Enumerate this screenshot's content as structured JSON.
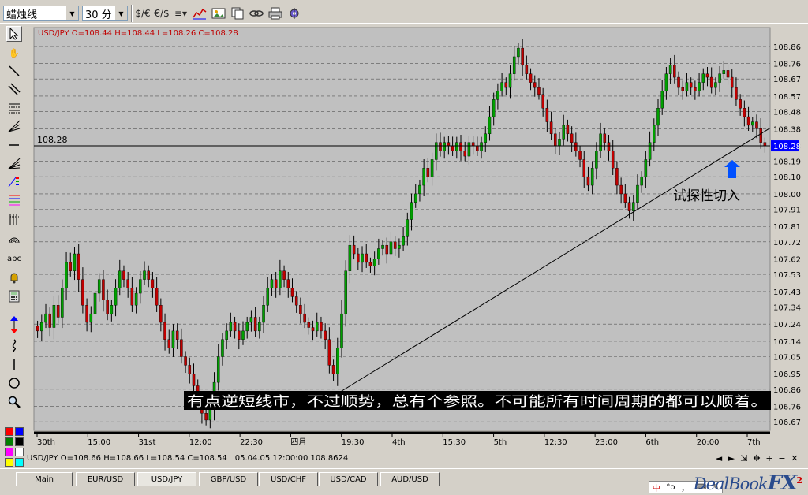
{
  "toolbar": {
    "chart_type": "蜡烛线",
    "timeframe": "30 分",
    "icons": [
      "dollar-euro-icon",
      "euro-dollar-icon",
      "indicator-icon",
      "chart-line-icon",
      "image-icon",
      "copy-icon",
      "link-icon",
      "print-icon",
      "settings-icon"
    ]
  },
  "left_tools": {
    "icons": [
      "cursor-icon",
      "hand-icon",
      "trendline-icon",
      "channel-icon",
      "gann-icon",
      "fan-icon",
      "horizontal-line-icon",
      "fibonacci-fan-icon",
      "cycle-icon",
      "fibonacci-icon",
      "grid-icon",
      "arc-icon",
      "text-icon",
      "bell-icon",
      "calculator-icon",
      "arrow-updown-icon",
      "wave-icon",
      "vertical-line-icon",
      "circle-icon",
      "zoom-icon"
    ],
    "text_tool_label": "abc",
    "colors": [
      "#ff0000",
      "#0000ff",
      "#008000",
      "#000000",
      "#ff00ff",
      "#ffffff",
      "#ffff00",
      "#00ffff",
      "#800000"
    ]
  },
  "chart": {
    "info": "USD/JPY O=108.44 H=108.44 L=108.26 C=108.28",
    "hline_label": "108.28",
    "price_tag": "108.28",
    "price_tag_color": "#0000ff",
    "annotation": "试探性切入",
    "caption": "有点逆短线市，不过顺势，总有个参照。不可能所有时间周期的都可以顺着。",
    "colors": {
      "background": "#c0c0c0",
      "bull": "#00a000",
      "bear": "#c00000",
      "wick": "#000000",
      "arrow": "#0050ff"
    }
  },
  "chart_data": {
    "type": "candlestick",
    "symbol": "USD/JPY",
    "timeframe": "30 分",
    "y_ticks": [
      108.86,
      108.76,
      108.67,
      108.57,
      108.48,
      108.38,
      108.28,
      108.19,
      108.1,
      108.0,
      107.91,
      107.81,
      107.72,
      107.62,
      107.53,
      107.43,
      107.34,
      107.24,
      107.14,
      107.05,
      106.95,
      106.86,
      106.76,
      106.67
    ],
    "ylim": [
      106.62,
      108.97
    ],
    "x_ticks": [
      "30th",
      "15:00",
      "31st",
      "12:00",
      "22:30",
      "四月",
      "19:30",
      "4th",
      "15:30",
      "5th",
      "12:30",
      "23:00",
      "6th",
      "20:00",
      "7th"
    ],
    "current_price": 108.28,
    "trendline": {
      "from": {
        "bar": 72,
        "price": 106.82
      },
      "to": {
        "bar": 178,
        "price": 108.38
      }
    },
    "closes": [
      107.2,
      107.25,
      107.3,
      107.22,
      107.35,
      107.28,
      107.45,
      107.6,
      107.55,
      107.65,
      107.5,
      107.35,
      107.25,
      107.3,
      107.42,
      107.5,
      107.38,
      107.3,
      107.35,
      107.45,
      107.55,
      107.5,
      107.45,
      107.35,
      107.42,
      107.5,
      107.55,
      107.5,
      107.45,
      107.35,
      107.25,
      107.15,
      107.1,
      107.2,
      107.15,
      107.05,
      107.0,
      106.95,
      106.88,
      106.8,
      106.72,
      106.68,
      106.75,
      106.9,
      107.05,
      107.15,
      107.2,
      107.25,
      107.2,
      107.15,
      107.2,
      107.25,
      107.28,
      107.2,
      107.25,
      107.35,
      107.45,
      107.5,
      107.45,
      107.55,
      107.5,
      107.45,
      107.4,
      107.35,
      107.3,
      107.25,
      107.22,
      107.2,
      107.25,
      107.2,
      107.15,
      107.0,
      106.95,
      107.1,
      107.3,
      107.55,
      107.7,
      107.65,
      107.6,
      107.65,
      107.6,
      107.58,
      107.62,
      107.68,
      107.7,
      107.65,
      107.72,
      107.68,
      107.7,
      107.75,
      107.85,
      107.95,
      108.0,
      108.05,
      108.15,
      108.1,
      108.2,
      108.3,
      108.25,
      108.3,
      108.28,
      108.25,
      108.3,
      108.25,
      108.22,
      108.3,
      108.28,
      108.25,
      108.3,
      108.35,
      108.45,
      108.55,
      108.6,
      108.65,
      108.62,
      108.7,
      108.8,
      108.85,
      108.75,
      108.7,
      108.65,
      108.62,
      108.58,
      108.5,
      108.42,
      108.35,
      108.28,
      108.32,
      108.4,
      108.35,
      108.3,
      108.25,
      108.2,
      108.1,
      108.05,
      108.15,
      108.25,
      108.35,
      108.3,
      108.25,
      108.15,
      108.05,
      108.0,
      107.95,
      107.9,
      107.95,
      108.05,
      108.1,
      108.2,
      108.3,
      108.4,
      108.5,
      108.6,
      108.7,
      108.75,
      108.68,
      108.62,
      108.6,
      108.65,
      108.62,
      108.6,
      108.65,
      108.7,
      108.68,
      108.62,
      108.65,
      108.7,
      108.72,
      108.68,
      108.62,
      108.55,
      108.5,
      108.45,
      108.4,
      108.42,
      108.38,
      108.3,
      108.28
    ]
  },
  "status": {
    "ohlc": "USD/JPY O=108.66 H=108.66 L=108.54 C=108.54",
    "info": "05.04.05 12:00:00 108.8624"
  },
  "tabs": [
    "Main",
    "EUR/USD",
    "USD/JPY",
    "GBP/USD",
    "USD/CHF",
    "USD/CAD",
    "AUD/USD"
  ],
  "active_tab": "USD/JPY",
  "brand": {
    "name": "DealBook",
    "suffix": "FX",
    "version": "2"
  },
  "ime": [
    "中",
    "°o",
    "，",
    "⌨",
    "✎"
  ]
}
